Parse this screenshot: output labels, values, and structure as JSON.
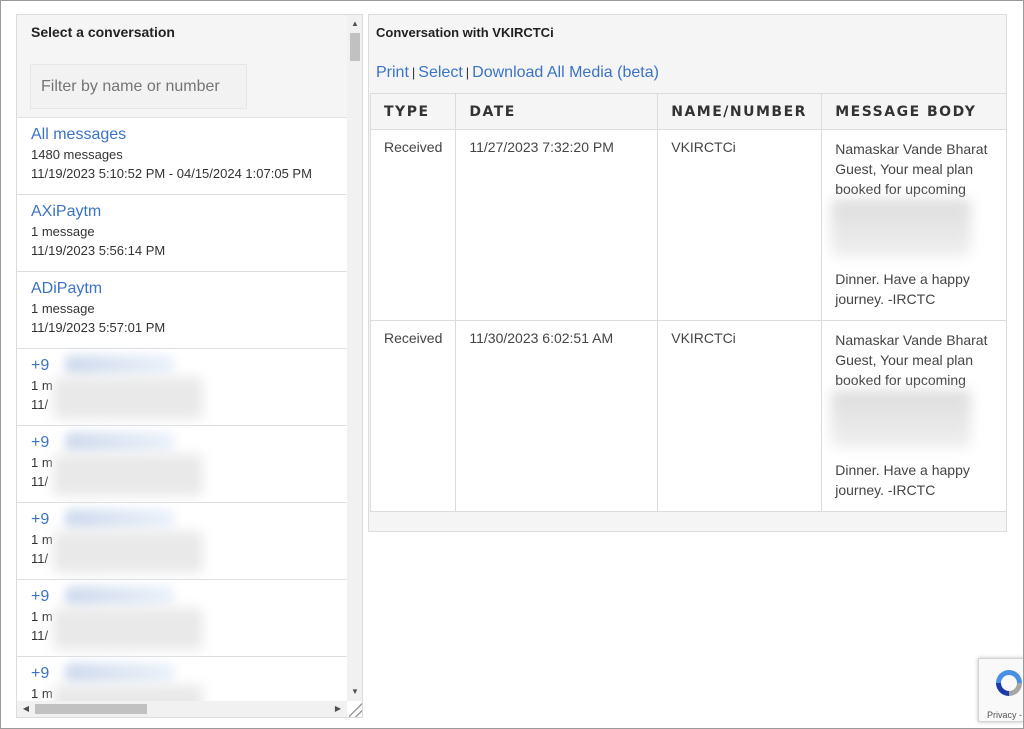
{
  "left": {
    "title": "Select a conversation",
    "filter_placeholder": "Filter by name or number",
    "conversations": [
      {
        "name": "All messages",
        "count": "1480 messages",
        "date": "11/19/2023 5:10:52 PM - 04/15/2024 1:07:05 PM"
      },
      {
        "name": "AXiPaytm",
        "count": "1 message",
        "date": "11/19/2023 5:56:14 PM"
      },
      {
        "name": "ADiPaytm",
        "count": "1 message",
        "date": "11/19/2023 5:57:01 PM"
      },
      {
        "name": "+9",
        "count": "1 m",
        "date": "11/"
      },
      {
        "name": "+9",
        "count": "1 m",
        "date": "11/"
      },
      {
        "name": "+9",
        "count": "1 m",
        "date": "11/"
      },
      {
        "name": "+9",
        "count": "1 m",
        "date": "11/"
      },
      {
        "name": "+9",
        "count": "1 m",
        "date": ""
      }
    ]
  },
  "right": {
    "title": "Conversation with VKIRCTCi",
    "actions": {
      "print": "Print",
      "select": "Select",
      "download": "Download All Media (beta)",
      "separator": "|"
    },
    "table": {
      "headers": [
        "TYPE",
        "DATE",
        "NAME/NUMBER",
        "MESSAGE BODY"
      ],
      "rows": [
        {
          "type": "Received",
          "date": "11/27/2023 7:32:20 PM",
          "name": "VKIRCTCi",
          "body_start": "Namaskar Vande Bharat Guest, Your meal plan booked for upcoming",
          "body_end": "Dinner. Have a happy journey. -IRCTC"
        },
        {
          "type": "Received",
          "date": "11/30/2023 6:02:51 AM",
          "name": "VKIRCTCi",
          "body_start": "Namaskar Vande Bharat Guest, Your meal plan booked for upcoming",
          "body_end": "Dinner. Have a happy journey. -IRCTC"
        }
      ]
    }
  },
  "recaptcha": {
    "text": "Privacy - Terms"
  },
  "colors": {
    "link": "#3b73c6",
    "panel_bg": "#f5f5f5",
    "border": "#dcdcdc"
  }
}
